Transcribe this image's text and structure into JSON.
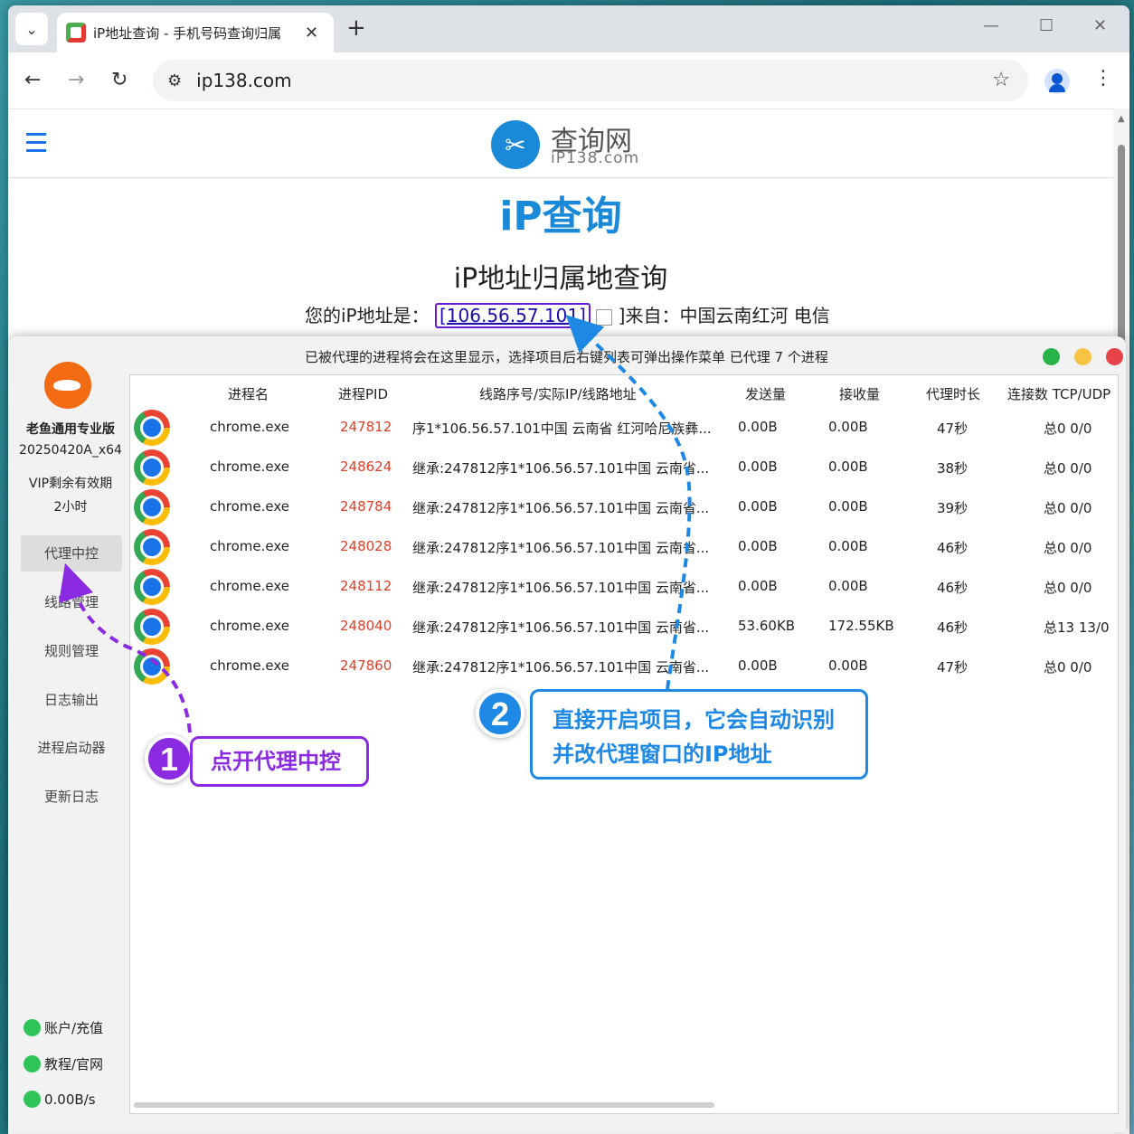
{
  "browser": {
    "tab_title": "iP地址查询 - 手机号码查询归属",
    "url": "ip138.com"
  },
  "site": {
    "logo_name": "查询网",
    "logo_domain": "iP138.com",
    "page_title": "iP查询",
    "subtitle": "iP地址归属地查询",
    "ip_prefix": "您的iP地址是：",
    "ip_value": "[106.56.57.101]",
    "ip_suffix": "]来自：中国云南红河 电信"
  },
  "app": {
    "info_text": "已被代理的进程将会在这里显示，选择项目后右键列表可弹出操作菜单   已代理 7 个进程",
    "product_name": "老鱼通用专业版",
    "version": "20250420A_x64",
    "vip_label": "VIP剩余有效期",
    "vip_remaining": "2小时",
    "menu": [
      "代理中控",
      "线路管理",
      "规则管理",
      "日志输出",
      "进程启动器",
      "更新日志"
    ],
    "status": [
      "账户/充值",
      "教程/官网",
      "0.00B/s"
    ],
    "columns": [
      "进程名",
      "进程PID",
      "线路序号/实际IP/线路地址",
      "发送量",
      "接收量",
      "代理时长",
      "连接数 TCP/UDP"
    ],
    "rows": [
      {
        "name": "chrome.exe",
        "pid": "247812",
        "route": "序1*106.56.57.101中国 云南省 红河哈尼族彝...",
        "sent": "0.00B",
        "recv": "0.00B",
        "dur": "47秒",
        "conn": "总0 0/0"
      },
      {
        "name": "chrome.exe",
        "pid": "248624",
        "route": "继承:247812序1*106.56.57.101中国 云南省...",
        "sent": "0.00B",
        "recv": "0.00B",
        "dur": "38秒",
        "conn": "总0 0/0"
      },
      {
        "name": "chrome.exe",
        "pid": "248784",
        "route": "继承:247812序1*106.56.57.101中国 云南省...",
        "sent": "0.00B",
        "recv": "0.00B",
        "dur": "39秒",
        "conn": "总0 0/0"
      },
      {
        "name": "chrome.exe",
        "pid": "248028",
        "route": "继承:247812序1*106.56.57.101中国 云南省...",
        "sent": "0.00B",
        "recv": "0.00B",
        "dur": "46秒",
        "conn": "总0 0/0"
      },
      {
        "name": "chrome.exe",
        "pid": "248112",
        "route": "继承:247812序1*106.56.57.101中国 云南省...",
        "sent": "0.00B",
        "recv": "0.00B",
        "dur": "46秒",
        "conn": "总0 0/0"
      },
      {
        "name": "chrome.exe",
        "pid": "248040",
        "route": "继承:247812序1*106.56.57.101中国 云南省...",
        "sent": "53.60KB",
        "recv": "172.55KB",
        "dur": "46秒",
        "conn": "总13 13/0"
      },
      {
        "name": "chrome.exe",
        "pid": "247860",
        "route": "继承:247812序1*106.56.57.101中国 云南省...",
        "sent": "0.00B",
        "recv": "0.00B",
        "dur": "47秒",
        "conn": "总0 0/0"
      }
    ]
  },
  "annotations": {
    "step1_number": "1",
    "step1_text": "点开代理中控",
    "step2_number": "2",
    "step2_line1": "直接开启项目，它会自动识别",
    "step2_line2": "并改代理窗口的IP地址"
  },
  "colors": {
    "accent_blue": "#1a8ad8",
    "annotation_purple": "#8a2be2",
    "annotation_blue": "#1e88e5",
    "pid_red": "#e0402a"
  }
}
